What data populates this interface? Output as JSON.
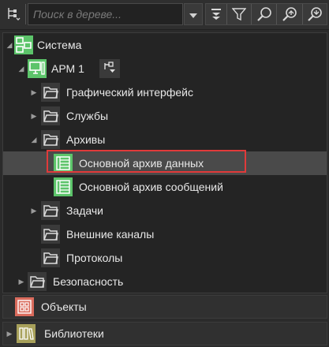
{
  "toolbar": {
    "search_placeholder": "Поиск в дереве...",
    "icons": [
      "tree-settings-icon",
      "dropdown-icon",
      "collapse-all-icon",
      "filter-icon",
      "search-icon",
      "search-up-icon",
      "search-down-icon"
    ]
  },
  "tree": {
    "nodes": [
      {
        "label": "Система",
        "icon": "system-icon",
        "expanded": true
      },
      {
        "label": "АРМ 1",
        "icon": "workstation-icon",
        "expanded": true
      },
      {
        "label": "Графический интерфейс",
        "icon": "folder-icon",
        "expanded": false
      },
      {
        "label": "Службы",
        "icon": "folder-icon",
        "expanded": false
      },
      {
        "label": "Архивы",
        "icon": "folder-icon",
        "expanded": true
      },
      {
        "label": "Основной архив данных",
        "icon": "archive-icon",
        "selected": true
      },
      {
        "label": "Основной архив сообщений",
        "icon": "archive-icon"
      },
      {
        "label": "Задачи",
        "icon": "folder-icon",
        "expanded": false
      },
      {
        "label": "Внешние каналы",
        "icon": "folder-icon"
      },
      {
        "label": "Протоколы",
        "icon": "folder-icon"
      },
      {
        "label": "Безопасность",
        "icon": "folder-icon",
        "expanded": false
      }
    ]
  },
  "sections": [
    {
      "label": "Объекты",
      "icon": "objects-icon",
      "color": "#d96b5c"
    },
    {
      "label": "Библиотеки",
      "icon": "libraries-icon",
      "color": "#a7a05a"
    }
  ],
  "colors": {
    "green_icon": "#5cc46a",
    "highlight": "#e03a3a",
    "selected_row": "#4a4a4a"
  }
}
